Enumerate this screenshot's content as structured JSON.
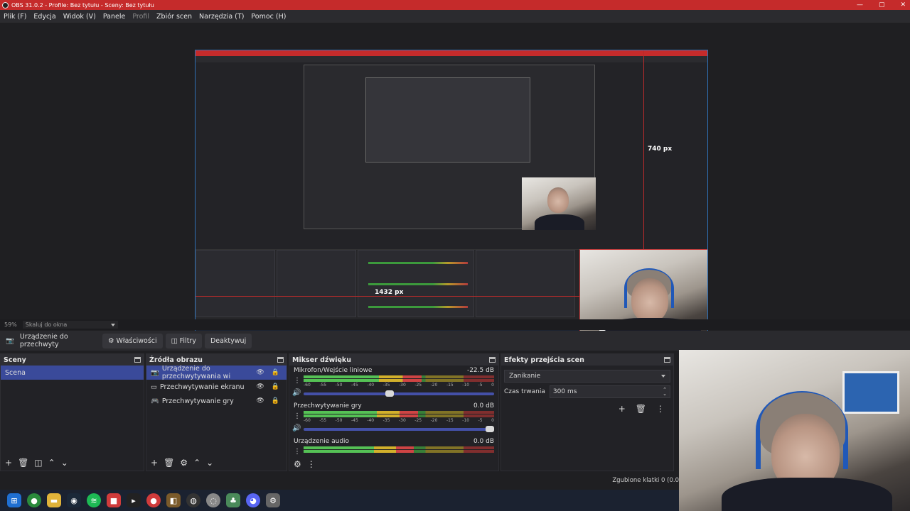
{
  "window": {
    "title": "OBS 31.0.2 - Profile: Bez tytułu - Sceny: Bez tytułu",
    "controls": [
      "—",
      "▢",
      "✕"
    ]
  },
  "menu": {
    "items": [
      "Plik (F)",
      "Edycja",
      "Widok (V)",
      "Panele",
      "Profil",
      "Zbiór scen",
      "Narzędzia (T)",
      "Pomoc (H)"
    ],
    "disabled_index": 4
  },
  "preview": {
    "measure_height": "740 px",
    "measure_width": "1432 px"
  },
  "zoom": {
    "percent": "59%",
    "mode": "Skaluj do okna"
  },
  "source_toolbar": {
    "source_name": "Urządzenie do przechwyty",
    "properties": "Właściwości",
    "filters": "Filtry",
    "deactivate": "Deaktywuj"
  },
  "scenes": {
    "title": "Sceny",
    "items": [
      "Scena"
    ]
  },
  "sources": {
    "title": "Źródła obrazu",
    "items": [
      {
        "label": "Urządzenie do przechwytywania wi",
        "icon": "camera-icon"
      },
      {
        "label": "Przechwytywanie ekranu",
        "icon": "monitor-icon"
      },
      {
        "label": "Przechwytywanie gry",
        "icon": "gamepad-icon"
      }
    ]
  },
  "mixer": {
    "title": "Mikser dźwięku",
    "scale": [
      "-60",
      "-55",
      "-50",
      "-45",
      "-40",
      "-35",
      "-30",
      "-25",
      "-20",
      "-15",
      "-10",
      "-5",
      "0"
    ],
    "channels": [
      {
        "name": "Mikrofon/Wejście liniowe",
        "db": "-22.5 dB",
        "level": 0.62,
        "volume": 0.45
      },
      {
        "name": "Przechwytywanie gry",
        "db": "0.0 dB",
        "level": 0.6,
        "volume": 1.0
      },
      {
        "name": "Urządzenie audio",
        "db": "0.0 dB",
        "level": 0.58,
        "volume": 1.0
      }
    ]
  },
  "transitions": {
    "title": "Efekty przejścia scen",
    "selected": "Zanikanie",
    "duration_label": "Czas trwania",
    "duration_value": "300 ms"
  },
  "status": {
    "dropped_frames": "Zgubione klatki 0 (0.0"
  },
  "colors": {
    "accent": "#3a4a9a",
    "titlebar": "#c52b2b",
    "selection_border": "#2f6fb5",
    "guide_line": "#b72b2b"
  }
}
